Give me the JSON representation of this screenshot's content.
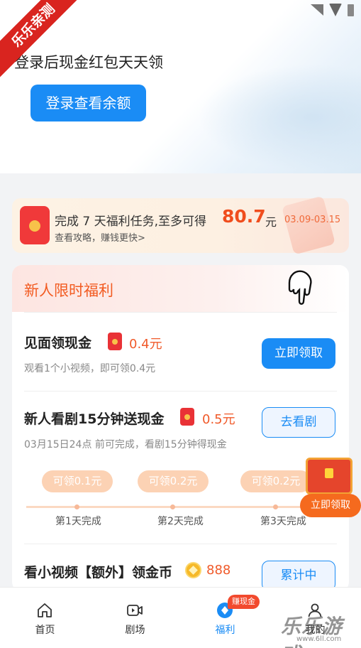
{
  "watermark": {
    "corner_text": "乐乐亲测",
    "site_text": "乐乐游戏",
    "site_url": "www.6ll.com"
  },
  "header": {
    "title": "登录后现金红包天天领",
    "login_button": "登录查看余额"
  },
  "banner": {
    "text_prefix": "完成 7 天福利任务,至多可得",
    "amount": "80.7",
    "unit": "元",
    "dates": "03.09-03.15",
    "subtitle": "查看攻略，赚钱更快>"
  },
  "newbie": {
    "title": "新人限时福利",
    "tasks": [
      {
        "title": "见面领现金",
        "reward": "0.4元",
        "desc": "观看1个小视频，即可领0.4元",
        "button": "立即领取"
      },
      {
        "title": "新人看剧15分钟送现金",
        "reward": "0.5元",
        "desc": "03月15日24点 前可完成，看剧15分钟得现金",
        "button": "去看剧"
      },
      {
        "title": "看小视频【额外】领金币",
        "reward": "888",
        "button": "累计中"
      }
    ],
    "progress": [
      {
        "pill": "可领0.1元",
        "label": "第1天完成"
      },
      {
        "pill": "可领0.2元",
        "label": "第2天完成"
      },
      {
        "pill": "可领0.2元",
        "label": "第3天完成"
      }
    ],
    "chest_button": "立即领取"
  },
  "tabbar": {
    "items": [
      {
        "label": "首页",
        "icon": "home-icon"
      },
      {
        "label": "剧场",
        "icon": "video-icon"
      },
      {
        "label": "福利",
        "icon": "welfare-icon",
        "badge": "赚现金"
      },
      {
        "label": "我的",
        "icon": "profile-icon"
      }
    ]
  },
  "colors": {
    "primary": "#1a8cf5",
    "accent": "#f04d1d",
    "pill": "#fcd2b4"
  }
}
